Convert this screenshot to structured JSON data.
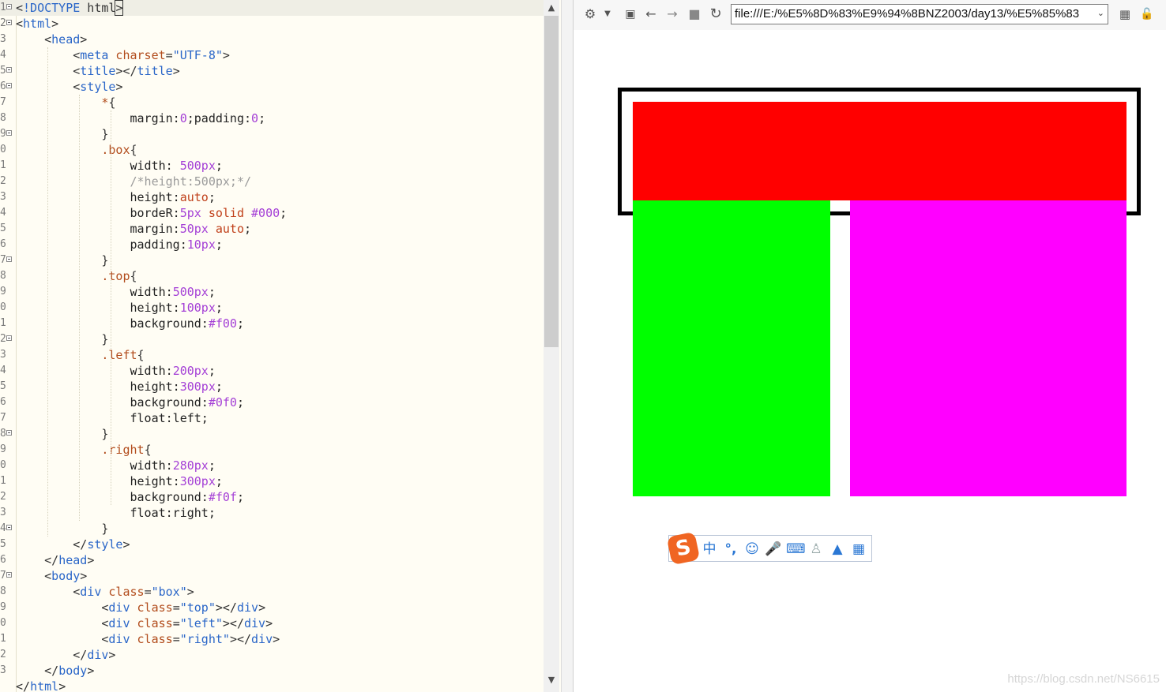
{
  "editor": {
    "gutter_numbers": [
      "1",
      "2",
      "3",
      "4",
      "5",
      "6",
      "7",
      "8",
      "9",
      "0",
      "1",
      "2",
      "3",
      "4",
      "5",
      "6",
      "7",
      "8",
      "9",
      "0",
      "1",
      "2",
      "3",
      "4",
      "5",
      "6",
      "7",
      "8",
      "9",
      "0",
      "1",
      "2",
      "3",
      "4",
      "5",
      "6",
      "7",
      "8",
      "9",
      "0",
      "1",
      "2",
      "3"
    ],
    "fold_lines": [
      1,
      2,
      5,
      6,
      9,
      17,
      22,
      28,
      34,
      37
    ],
    "lines": [
      [
        [
          "t-punct",
          "<"
        ],
        [
          "t-tag",
          "!DOCTYPE"
        ],
        [
          "t-punct",
          " html"
        ],
        [
          "t-punct cursorbox",
          ">"
        ]
      ],
      [
        [
          "t-punct",
          "<"
        ],
        [
          "t-tag",
          "html"
        ],
        [
          "t-punct",
          ">"
        ]
      ],
      [
        [
          "t-punct",
          "    <"
        ],
        [
          "t-tag",
          "head"
        ],
        [
          "t-punct",
          ">"
        ]
      ],
      [
        [
          "t-punct",
          "        <"
        ],
        [
          "t-tag",
          "meta"
        ],
        [
          "t-attr",
          " charset"
        ],
        [
          "t-punct",
          "="
        ],
        [
          "t-str",
          "\"UTF-8\""
        ],
        [
          "t-punct",
          ">"
        ]
      ],
      [
        [
          "t-punct",
          "        <"
        ],
        [
          "t-tag",
          "title"
        ],
        [
          "t-punct",
          "></"
        ],
        [
          "t-tag",
          "title"
        ],
        [
          "t-punct",
          ">"
        ]
      ],
      [
        [
          "t-punct",
          "        <"
        ],
        [
          "t-tag",
          "style"
        ],
        [
          "t-punct",
          ">"
        ]
      ],
      [
        [
          "t-sel",
          "            *"
        ],
        [
          "t-punct",
          "{"
        ]
      ],
      [
        [
          "t-prop",
          "                margin:"
        ],
        [
          "t-num",
          "0"
        ],
        [
          "t-prop",
          ";padding:"
        ],
        [
          "t-num",
          "0"
        ],
        [
          "t-prop",
          ";"
        ]
      ],
      [
        [
          "t-punct",
          "            }"
        ]
      ],
      [
        [
          "t-sel",
          "            .box"
        ],
        [
          "t-punct",
          "{"
        ]
      ],
      [
        [
          "t-prop",
          "                width: "
        ],
        [
          "t-num",
          "500px"
        ],
        [
          "t-prop",
          ";"
        ]
      ],
      [
        [
          "t-com",
          "                /*height:500px;*/"
        ]
      ],
      [
        [
          "t-prop",
          "                height:"
        ],
        [
          "t-kw",
          "auto"
        ],
        [
          "t-prop",
          ";"
        ]
      ],
      [
        [
          "t-prop",
          "                bordeR:"
        ],
        [
          "t-num",
          "5px"
        ],
        [
          "t-kw",
          " solid"
        ],
        [
          "t-num",
          " #000"
        ],
        [
          "t-prop",
          ";"
        ]
      ],
      [
        [
          "t-prop",
          "                margin:"
        ],
        [
          "t-num",
          "50px"
        ],
        [
          "t-kw",
          " auto"
        ],
        [
          "t-prop",
          ";"
        ]
      ],
      [
        [
          "t-prop",
          "                padding:"
        ],
        [
          "t-num",
          "10px"
        ],
        [
          "t-prop",
          ";"
        ]
      ],
      [
        [
          "t-punct",
          "            }"
        ]
      ],
      [
        [
          "t-sel",
          "            .top"
        ],
        [
          "t-punct",
          "{"
        ]
      ],
      [
        [
          "t-prop",
          "                width:"
        ],
        [
          "t-num",
          "500px"
        ],
        [
          "t-prop",
          ";"
        ]
      ],
      [
        [
          "t-prop",
          "                height:"
        ],
        [
          "t-num",
          "100px"
        ],
        [
          "t-prop",
          ";"
        ]
      ],
      [
        [
          "t-prop",
          "                background:"
        ],
        [
          "t-num",
          "#f00"
        ],
        [
          "t-prop",
          ";"
        ]
      ],
      [
        [
          "t-punct",
          "            }"
        ]
      ],
      [
        [
          "t-sel",
          "            .left"
        ],
        [
          "t-punct",
          "{"
        ]
      ],
      [
        [
          "t-prop",
          "                width:"
        ],
        [
          "t-num",
          "200px"
        ],
        [
          "t-prop",
          ";"
        ]
      ],
      [
        [
          "t-prop",
          "                height:"
        ],
        [
          "t-num",
          "300px"
        ],
        [
          "t-prop",
          ";"
        ]
      ],
      [
        [
          "t-prop",
          "                background:"
        ],
        [
          "t-num",
          "#0f0"
        ],
        [
          "t-prop",
          ";"
        ]
      ],
      [
        [
          "t-prop",
          "                float:left;"
        ]
      ],
      [
        [
          "t-punct",
          "            }"
        ]
      ],
      [
        [
          "t-sel",
          "            .right"
        ],
        [
          "t-punct",
          "{"
        ]
      ],
      [
        [
          "t-prop",
          "                width:"
        ],
        [
          "t-num",
          "280px"
        ],
        [
          "t-prop",
          ";"
        ]
      ],
      [
        [
          "t-prop",
          "                height:"
        ],
        [
          "t-num",
          "300px"
        ],
        [
          "t-prop",
          ";"
        ]
      ],
      [
        [
          "t-prop",
          "                background:"
        ],
        [
          "t-num",
          "#f0f"
        ],
        [
          "t-prop",
          ";"
        ]
      ],
      [
        [
          "t-prop",
          "                float:right;"
        ]
      ],
      [
        [
          "t-punct",
          "            }"
        ]
      ],
      [
        [
          "t-punct",
          "        </"
        ],
        [
          "t-tag",
          "style"
        ],
        [
          "t-punct",
          ">"
        ]
      ],
      [
        [
          "t-punct",
          "    </"
        ],
        [
          "t-tag",
          "head"
        ],
        [
          "t-punct",
          ">"
        ]
      ],
      [
        [
          "t-punct",
          "    <"
        ],
        [
          "t-tag",
          "body"
        ],
        [
          "t-punct",
          ">"
        ]
      ],
      [
        [
          "t-punct",
          "        <"
        ],
        [
          "t-tag",
          "div"
        ],
        [
          "t-attr",
          " class"
        ],
        [
          "t-punct",
          "="
        ],
        [
          "t-str",
          "\"box\""
        ],
        [
          "t-punct",
          ">"
        ]
      ],
      [
        [
          "t-punct",
          "            <"
        ],
        [
          "t-tag",
          "div"
        ],
        [
          "t-attr",
          " class"
        ],
        [
          "t-punct",
          "="
        ],
        [
          "t-str",
          "\"top\""
        ],
        [
          "t-punct",
          "></"
        ],
        [
          "t-tag",
          "div"
        ],
        [
          "t-punct",
          ">"
        ]
      ],
      [
        [
          "t-punct",
          "            <"
        ],
        [
          "t-tag",
          "div"
        ],
        [
          "t-attr",
          " class"
        ],
        [
          "t-punct",
          "="
        ],
        [
          "t-str",
          "\"left\""
        ],
        [
          "t-punct",
          "></"
        ],
        [
          "t-tag",
          "div"
        ],
        [
          "t-punct",
          ">"
        ]
      ],
      [
        [
          "t-punct",
          "            <"
        ],
        [
          "t-tag",
          "div"
        ],
        [
          "t-attr",
          " class"
        ],
        [
          "t-punct",
          "="
        ],
        [
          "t-str",
          "\"right\""
        ],
        [
          "t-punct",
          "></"
        ],
        [
          "t-tag",
          "div"
        ],
        [
          "t-punct",
          ">"
        ]
      ],
      [
        [
          "t-punct",
          "        </"
        ],
        [
          "t-tag",
          "div"
        ],
        [
          "t-punct",
          ">"
        ]
      ],
      [
        [
          "t-punct",
          "    </"
        ],
        [
          "t-tag",
          "body"
        ],
        [
          "t-punct",
          ">"
        ]
      ],
      [
        [
          "t-punct",
          "</"
        ],
        [
          "t-tag",
          "html"
        ],
        [
          "t-punct",
          ">"
        ]
      ]
    ]
  },
  "browser": {
    "toolbar": {
      "settings_icon": "gear-icon",
      "url": "file:///E:/%E5%8D%83%E9%94%8BNZ2003/day13/%E5%85%83"
    },
    "page": {
      "top_color": "#ff0000",
      "left_color": "#00ff00",
      "right_color": "#ff00ff",
      "border_color": "#000000"
    },
    "ime": {
      "logo": "S",
      "mode": "中",
      "punct": "°,"
    }
  },
  "watermark": "https://blog.csdn.net/NS6615"
}
